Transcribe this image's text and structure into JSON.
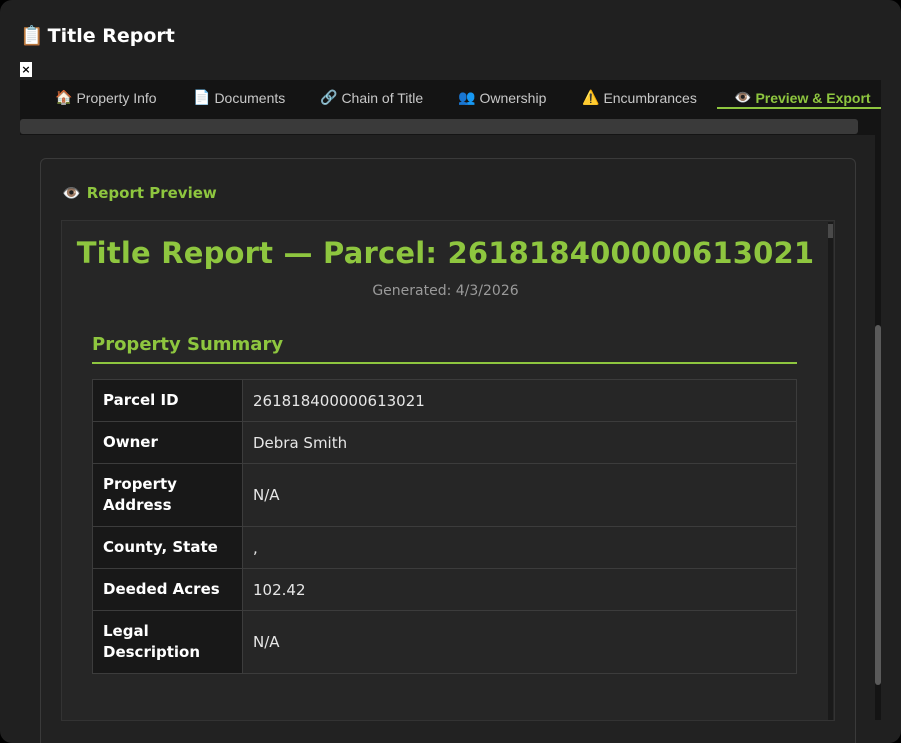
{
  "window": {
    "title": "Title Report",
    "title_icon": "📋",
    "close_label": "×"
  },
  "tabs": [
    {
      "icon": "🏠",
      "label": "Property Info"
    },
    {
      "icon": "📄",
      "label": "Documents"
    },
    {
      "icon": "🔗",
      "label": "Chain of Title"
    },
    {
      "icon": "👥",
      "label": "Ownership"
    },
    {
      "icon": "⚠️",
      "label": "Encumbrances"
    },
    {
      "icon": "👁️",
      "label": "Preview & Export",
      "active": true
    }
  ],
  "preview": {
    "icon": "👁️",
    "heading": "Report Preview"
  },
  "report": {
    "title": "Title Report — Parcel: 261818400000613021",
    "generated": "Generated: 4/3/2026",
    "section_title": "Property Summary",
    "rows": [
      {
        "key": "Parcel ID",
        "value": "261818400000613021"
      },
      {
        "key": "Owner",
        "value": "Debra Smith"
      },
      {
        "key": "Property Address",
        "value": "N/A"
      },
      {
        "key": "County, State",
        "value": ","
      },
      {
        "key": "Deeded Acres",
        "value": "102.42"
      },
      {
        "key": "Legal Description",
        "value": "N/A"
      }
    ]
  },
  "colors": {
    "accent": "#8ec63f",
    "background": "#202020"
  }
}
